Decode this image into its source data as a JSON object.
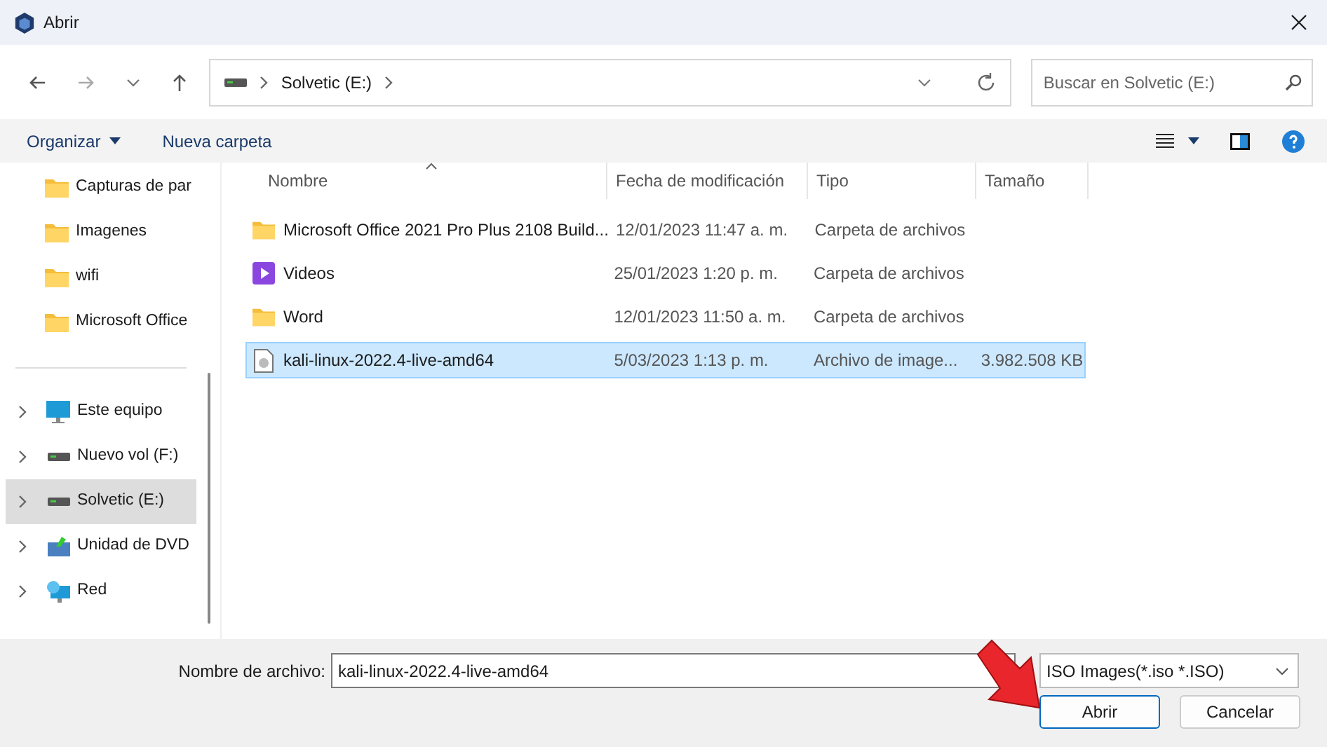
{
  "window": {
    "title": "Abrir"
  },
  "address_bar": {
    "crumbs": [
      "Solvetic (E:)"
    ]
  },
  "search": {
    "placeholder": "Buscar en Solvetic (E:)"
  },
  "toolbar": {
    "organize": "Organizar",
    "new_folder": "Nueva carpeta"
  },
  "sidebar": {
    "quick_items": [
      {
        "label": "Capturas de par",
        "kind": "folder"
      },
      {
        "label": "Imagenes",
        "kind": "folder"
      },
      {
        "label": "wifi",
        "kind": "folder"
      },
      {
        "label": "Microsoft Office",
        "kind": "folder"
      }
    ],
    "drives": [
      {
        "label": "Este equipo",
        "kind": "pc",
        "selected": false
      },
      {
        "label": "Nuevo vol (F:)",
        "kind": "drive",
        "selected": false
      },
      {
        "label": "Solvetic (E:)",
        "kind": "drive",
        "selected": true
      },
      {
        "label": "Unidad de DVD",
        "kind": "dvd",
        "selected": false
      },
      {
        "label": "Red",
        "kind": "network",
        "selected": false
      }
    ]
  },
  "table": {
    "columns": [
      "Nombre",
      "Fecha de modificación",
      "Tipo",
      "Tamaño"
    ],
    "rows": [
      {
        "name": "Microsoft Office 2021 Pro Plus 2108 Build...",
        "date": "12/01/2023 11:47 a. m.",
        "type": "Carpeta de archivos",
        "kind": "folder",
        "selected": false
      },
      {
        "name": "Videos",
        "date": "25/01/2023 1:20 p. m.",
        "type": "Carpeta de archivos",
        "kind": "videos",
        "selected": false
      },
      {
        "name": "Word",
        "date": "12/01/2023 11:50 a. m.",
        "type": "Carpeta de archivos",
        "kind": "folder",
        "selected": false
      },
      {
        "name": "kali-linux-2022.4-live-amd64",
        "date": "5/03/2023 1:13 p. m.",
        "type": "Archivo de image...",
        "size": "3.982.508 KB",
        "kind": "file",
        "selected": true
      }
    ]
  },
  "footer": {
    "filename_label": "Nombre de archivo:",
    "filename": "kali-linux-2022.4-live-amd64",
    "filter": "ISO Images(*.iso *.ISO)",
    "buttons": [
      "Abrir",
      "Cancelar"
    ]
  }
}
